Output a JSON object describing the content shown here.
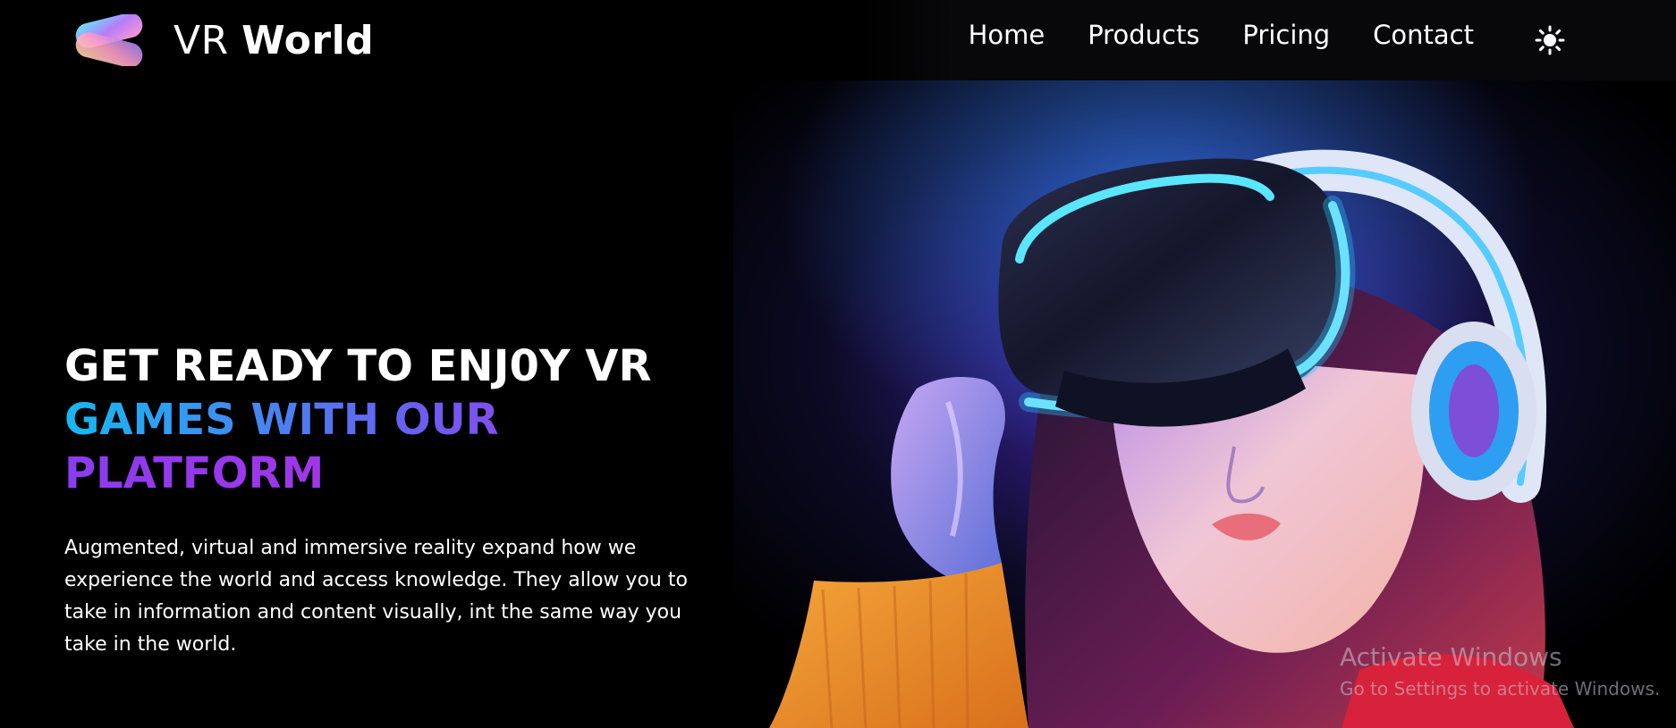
{
  "brand": {
    "name_light": "VR",
    "name_bold": "World",
    "logo_icon": "infinity-blob-logo-icon"
  },
  "nav": {
    "items": [
      {
        "label": "Home"
      },
      {
        "label": "Products"
      },
      {
        "label": "Pricing"
      },
      {
        "label": "Contact"
      }
    ],
    "theme_toggle_icon": "sun-icon"
  },
  "hero": {
    "title_line1": "GET READY TO ENJ0Y VR",
    "title_line2": "GAMES WITH OUR",
    "title_line3": "PLATFORM",
    "description": "Augmented, virtual and immersive reality expand how we experience the world and access knowledge. They allow you to take in information and content visually, int the same way you take in the world."
  },
  "watermark": {
    "title": "Activate Windows",
    "subtitle": "Go to Settings to activate Windows."
  },
  "colors": {
    "background": "#000000",
    "accent_cyan": "#16b8f2",
    "accent_purple": "#6d5bf0",
    "accent_magenta": "#c12ae0",
    "text": "#ffffff"
  }
}
